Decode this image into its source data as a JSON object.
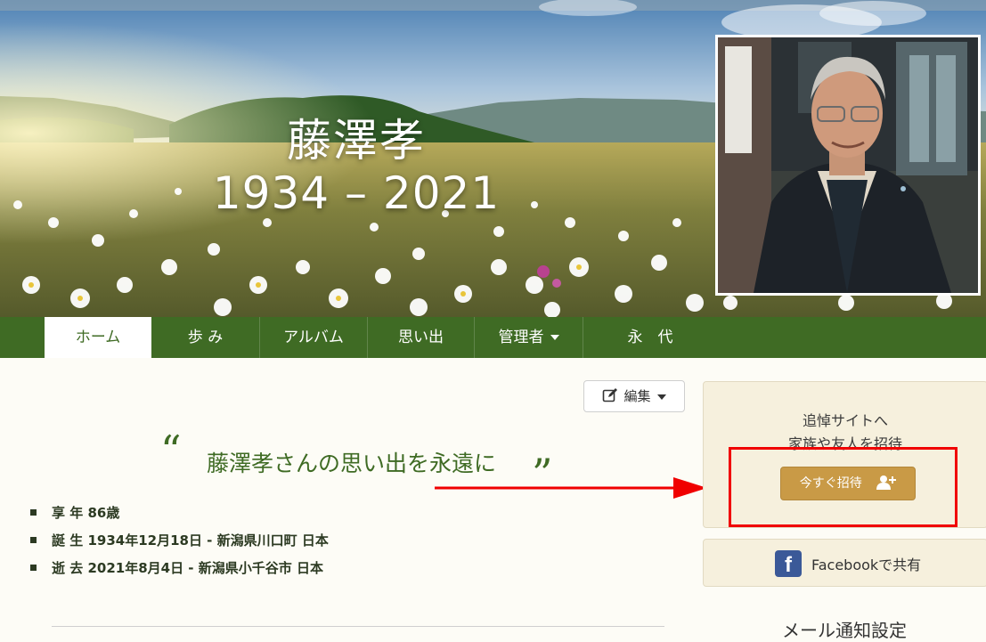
{
  "hero": {
    "name": "藤澤孝",
    "years": "1934 – 2021"
  },
  "nav": {
    "items": [
      {
        "label": "ホーム"
      },
      {
        "label": "歩 み"
      },
      {
        "label": "アルバム"
      },
      {
        "label": "思い出"
      },
      {
        "label": "管理者"
      },
      {
        "label": "永　代"
      }
    ]
  },
  "main": {
    "edit_label": "編集",
    "memory_text": "藤澤孝さんの思い出を永遠に",
    "quote_open": "“",
    "quote_close": "”",
    "facts": [
      "享 年 86歳",
      "誕 生 1934年12月18日 - 新潟県川口町 日本",
      "逝 去 2021年8月4日 - 新潟県小千谷市 日本"
    ]
  },
  "sidebar": {
    "invite_line1": "追悼サイトへ",
    "invite_line2": "家族や友人を招待",
    "invite_button": "今すぐ招待",
    "facebook_icon_glyph": "f",
    "facebook_label": "Facebookで共有",
    "mail_settings": "メール通知設定"
  },
  "colors": {
    "nav_green": "#3f6b24",
    "invite_button": "#c99a46",
    "annotation_red": "#f00000",
    "facebook_blue": "#3b5998"
  }
}
